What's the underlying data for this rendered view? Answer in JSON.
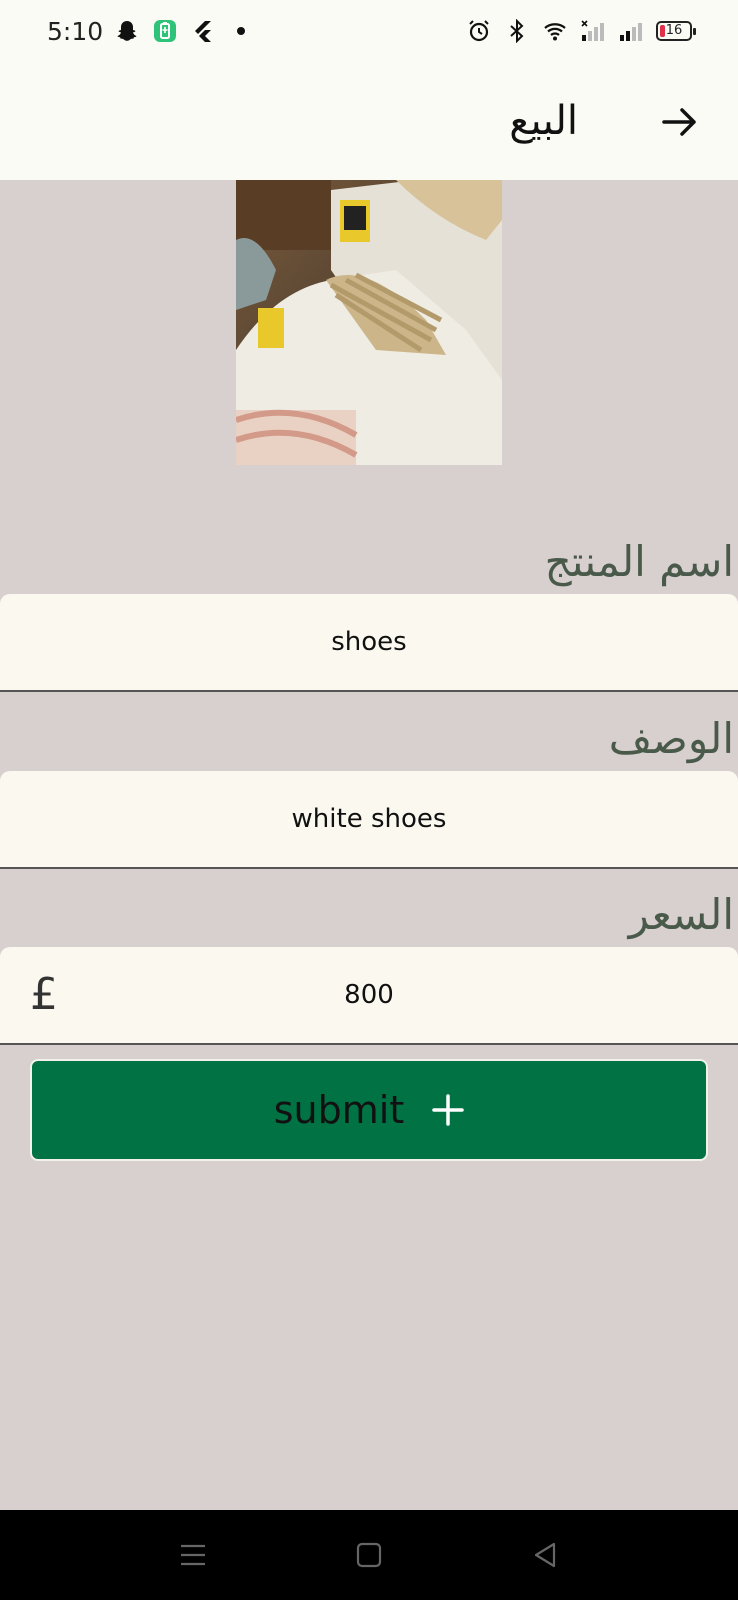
{
  "status_bar": {
    "time": "5:10",
    "battery_level": "16",
    "icons_left": [
      "snapchat-icon",
      "battery-saver-icon",
      "flutter-icon",
      "dot-icon"
    ],
    "icons_right": [
      "alarm-icon",
      "bluetooth-icon",
      "wifi-icon",
      "signal-icon",
      "signal-icon",
      "battery-icon"
    ]
  },
  "app_bar": {
    "title": "البيع",
    "back_icon": "arrow-right-icon"
  },
  "product_image": {
    "description_icon": "product-photo"
  },
  "form": {
    "name_label": "اسم المنتج",
    "name_value": "shoes",
    "description_label": "الوصف",
    "description_value": "white shoes",
    "price_label": "السعر",
    "price_value": "800",
    "currency_symbol": "£"
  },
  "submit": {
    "label": "submit",
    "icon": "plus-icon"
  },
  "nav_bar": {
    "icons": [
      "menu-icon",
      "home-square-icon",
      "back-triangle-icon"
    ]
  },
  "colors": {
    "background": "#d8cfcf",
    "appbar": "#fbfbf5",
    "field": "#fbf9ef",
    "accent": "#007243"
  }
}
